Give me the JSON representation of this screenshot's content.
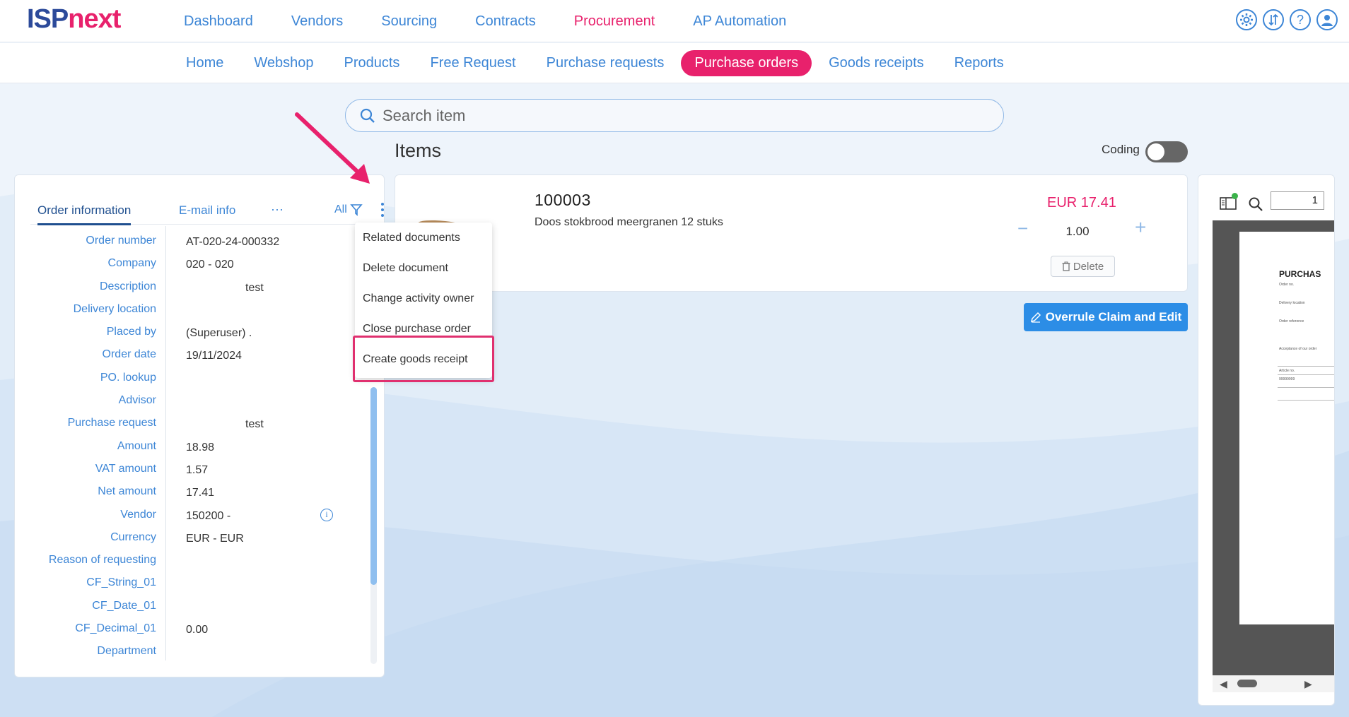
{
  "brand": {
    "part1": "ISP",
    "part2": "next"
  },
  "main_nav": [
    {
      "label": "Dashboard",
      "active": false
    },
    {
      "label": "Vendors",
      "active": false
    },
    {
      "label": "Sourcing",
      "active": false
    },
    {
      "label": "Contracts",
      "active": false
    },
    {
      "label": "Procurement",
      "active": true
    },
    {
      "label": "AP Automation",
      "active": false
    }
  ],
  "top_icons": [
    "settings-icon",
    "transfer-icon",
    "help-icon",
    "user-icon"
  ],
  "sub_nav": [
    {
      "label": "Home",
      "active": false
    },
    {
      "label": "Webshop",
      "active": false
    },
    {
      "label": "Products",
      "active": false
    },
    {
      "label": "Free Request",
      "active": false
    },
    {
      "label": "Purchase requests",
      "active": false
    },
    {
      "label": "Purchase orders",
      "active": true
    },
    {
      "label": "Goods receipts",
      "active": false
    },
    {
      "label": "Reports",
      "active": false
    }
  ],
  "search": {
    "placeholder": "Search item"
  },
  "left_panel": {
    "tabs": {
      "order_info": "Order information",
      "email_info": "E-mail info",
      "more": "···",
      "all": "All"
    },
    "fields": [
      {
        "label": "Order number",
        "value": "AT-020-24-000332"
      },
      {
        "label": "Company",
        "value": "020 - 020"
      },
      {
        "label": "Description",
        "value": "test"
      },
      {
        "label": "Delivery location",
        "value": ""
      },
      {
        "label": "Placed by",
        "value": "(Superuser) ."
      },
      {
        "label": "Order date",
        "value": "19/11/2024"
      },
      {
        "label": "PO. lookup",
        "value": ""
      },
      {
        "label": "Advisor",
        "value": ""
      },
      {
        "label": "Purchase request",
        "value": "test"
      },
      {
        "label": "Amount",
        "value": "18.98"
      },
      {
        "label": "VAT amount",
        "value": "1.57"
      },
      {
        "label": "Net amount",
        "value": "17.41"
      },
      {
        "label": "Vendor",
        "value": "150200 -"
      },
      {
        "label": "Currency",
        "value": "EUR - EUR"
      },
      {
        "label": "Reason of requesting",
        "value": ""
      },
      {
        "label": "CF_String_01",
        "value": ""
      },
      {
        "label": "CF_Date_01",
        "value": ""
      },
      {
        "label": "CF_Decimal_01",
        "value": "0.00"
      },
      {
        "label": "Department",
        "value": ""
      }
    ]
  },
  "menu": {
    "items": [
      "Related documents",
      "Delete document",
      "Change activity owner",
      "Close purchase order",
      "Create goods receipt"
    ]
  },
  "items": {
    "title": "Items",
    "coding_label": "Coding",
    "coding_on": false,
    "card": {
      "code": "100003",
      "description": "Doos stokbrood meergranen 12 stuks",
      "price": "EUR 17.41",
      "quantity": "1.00",
      "minus": "−",
      "plus": "+",
      "delete_label": "Delete"
    },
    "overrule_label": "Overrule Claim and Edit"
  },
  "preview": {
    "page": "1",
    "doc_title": "PURCHAS",
    "tiny_labels": [
      "Order no.",
      "Delivery location",
      "Order reference",
      "Acceptance of our order",
      "Article no.",
      "99999999"
    ]
  },
  "colors": {
    "accent": "#e8216c",
    "link": "#3d86d6",
    "brand_blue": "#2c4a9a",
    "button_blue": "#2c8de6"
  }
}
